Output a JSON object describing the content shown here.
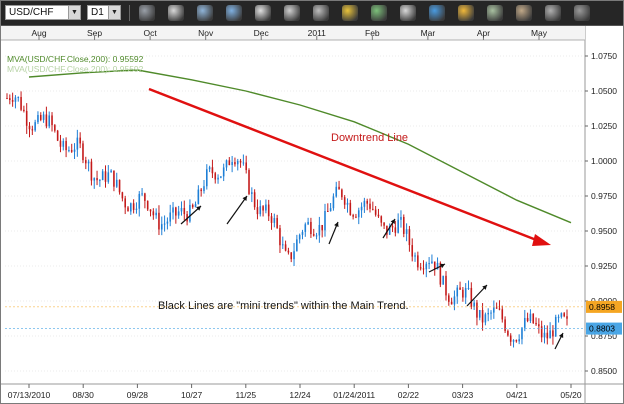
{
  "toolbar": {
    "symbol": "USD/CHF",
    "timeframe": "D1",
    "icons": [
      "chart-type-icon",
      "crosshair-icon",
      "indicator-icon",
      "line-study-icon",
      "cursor-icon",
      "draw-tools-icon",
      "text-tool-icon",
      "fibonacci-icon",
      "properties-icon",
      "color-icon",
      "globe-icon",
      "pencil-icon",
      "levels-icon",
      "template-icon",
      "settings-icon",
      "options-icon"
    ]
  },
  "colors": {
    "candle_up": "#1e7fd6",
    "candle_down": "#c41a1a",
    "ma_line": "#4f8a2a",
    "trend_arrow": "#e01010",
    "annotation_text": "#c41a1a",
    "mini_arrow": "#111111",
    "price_tag_1": "#f5a623",
    "price_tag_2": "#4aa6e6",
    "grid": "#d8d8d8"
  },
  "chart_data": {
    "type": "line",
    "symbol": "USD/CHF",
    "timeframe": "D1",
    "legend": [
      {
        "text": "MVA(USD/CHF.Close,200): 0.95592",
        "color": "#4f8a2a"
      },
      {
        "text": "MVA(USD/CHF.Close,200): 0.95592",
        "color": "#b6d2a4"
      }
    ],
    "month_labels": [
      "Aug",
      "Sep",
      "Oct",
      "Nov",
      "Dec",
      "2011",
      "Feb",
      "Mar",
      "Apr",
      "May"
    ],
    "date_labels": [
      "07/13/2010",
      "08/30",
      "09/28",
      "10/27",
      "11/25",
      "12/24",
      "01/24/2011",
      "02/22",
      "03/23",
      "04/21",
      "05/20"
    ],
    "y_ticks": [
      "1.0750",
      "1.0500",
      "1.0250",
      "1.0000",
      "0.9750",
      "0.9500",
      "0.9250",
      "0.9000",
      "0.8750",
      "0.8500"
    ],
    "ylim": [
      0.845,
      1.085
    ],
    "price_markers": [
      {
        "value": 0.8958,
        "label": "0.8958",
        "color": "#f5a623"
      },
      {
        "value": 0.8803,
        "label": "0.8803",
        "color": "#4aa6e6"
      }
    ],
    "series": [
      {
        "name": "MVA(USD/CHF.Close,200)",
        "points": [
          [
            "07/13/2010",
            1.06
          ],
          [
            "08/30",
            1.063
          ],
          [
            "09/28",
            1.065
          ],
          [
            "10/27",
            1.058
          ],
          [
            "11/25",
            1.05
          ],
          [
            "12/24",
            1.04
          ],
          [
            "01/24/2011",
            1.028
          ],
          [
            "02/22",
            1.012
          ],
          [
            "03/23",
            0.992
          ],
          [
            "04/21",
            0.972
          ],
          [
            "05/20",
            0.9559
          ]
        ]
      }
    ],
    "price_path": [
      [
        "07/13/2010",
        1.045
      ],
      [
        "08/30",
        1.015
      ],
      [
        "09/28",
        0.978
      ],
      [
        "10/27",
        0.955
      ],
      [
        "11/25",
        1.005
      ],
      [
        "12/24",
        0.935
      ],
      [
        "01/24/2011",
        0.975
      ],
      [
        "02/22",
        0.95
      ],
      [
        "03/23",
        0.905
      ],
      [
        "04/21",
        0.88
      ],
      [
        "05/20",
        0.8803
      ]
    ],
    "annotations": [
      {
        "text": "Downtrend Line",
        "color": "#c41a1a"
      },
      {
        "text": "Black Lines are \"mini trends\" within the Main Trend.",
        "color": "#111111"
      }
    ]
  }
}
